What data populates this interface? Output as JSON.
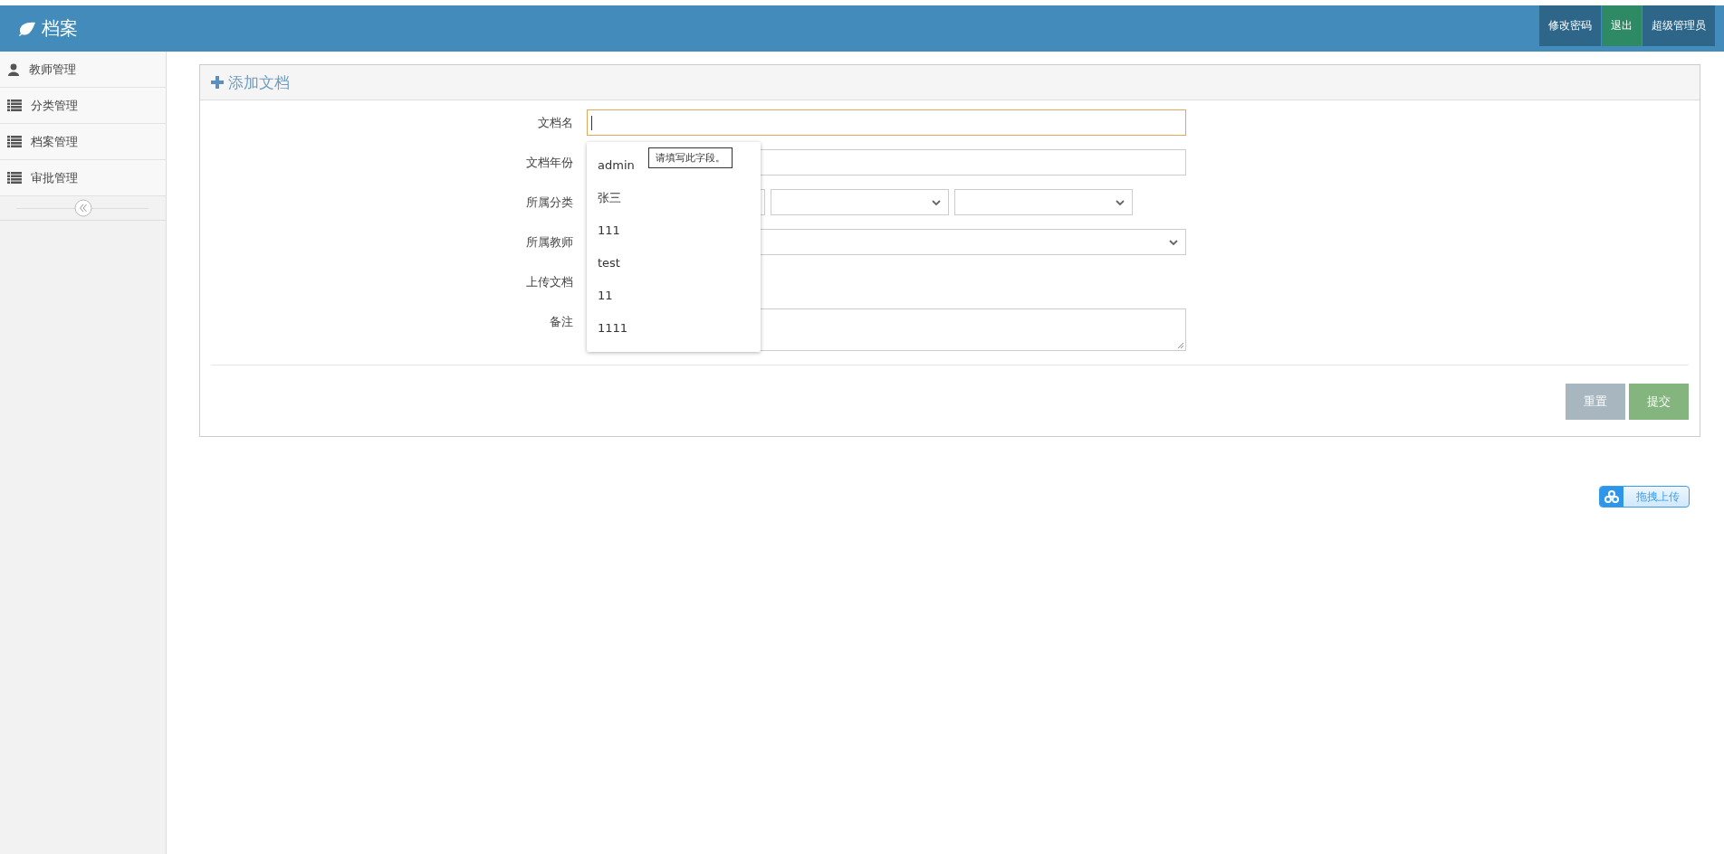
{
  "header": {
    "title": "档案",
    "buttons": [
      {
        "label": "修改密码",
        "kind": "primary"
      },
      {
        "label": "退出",
        "kind": "success"
      },
      {
        "label": "超级管理员",
        "kind": "primary"
      }
    ]
  },
  "sidebar": {
    "items": [
      {
        "label": "教师管理",
        "kind": "user",
        "selected": false
      },
      {
        "label": "分类管理",
        "kind": "list",
        "selected": false
      },
      {
        "label": "档案管理",
        "kind": "list",
        "selected": false
      },
      {
        "label": "审批管理",
        "kind": "list",
        "selected": false
      }
    ]
  },
  "panel": {
    "title": "添加文档",
    "fields": [
      {
        "label": "文档名",
        "kind": "text",
        "focused": true
      },
      {
        "label": "文档年份",
        "kind": "text",
        "focused": false
      },
      {
        "label": "所属分类",
        "kind": "category"
      },
      {
        "label": "所属教师",
        "kind": "select"
      },
      {
        "label": "上传文档",
        "kind": "file"
      },
      {
        "label": "备注",
        "kind": "textarea"
      }
    ],
    "autocomplete": [
      "admin",
      "张三",
      "111",
      "test",
      "11",
      "1111"
    ],
    "tooltip": "请填写此字段。",
    "actions": [
      {
        "label": "重置",
        "kind": "reset"
      },
      {
        "label": "提交",
        "kind": "submit"
      }
    ]
  },
  "upload_button": {
    "label": "拖拽上传"
  }
}
